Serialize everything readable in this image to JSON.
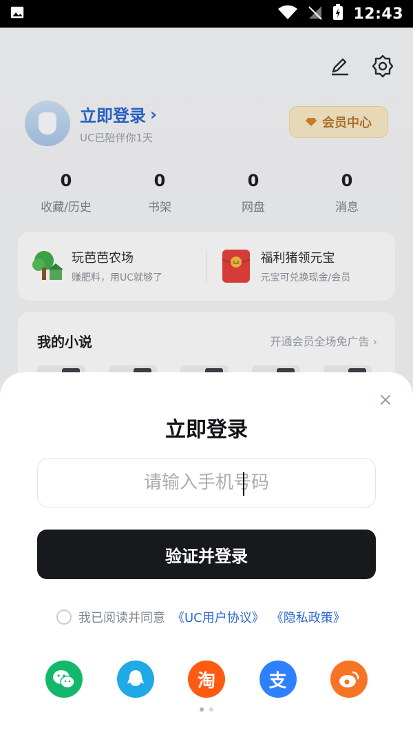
{
  "status_bar": {
    "time": "12:43",
    "icons": [
      "image-icon",
      "wifi-icon",
      "no-signal-icon",
      "battery-charging-icon"
    ]
  },
  "header": {
    "icons": [
      "edit-icon",
      "settings-icon"
    ]
  },
  "profile": {
    "login_label": "立即登录",
    "subtitle": "UC已陪伴你1天",
    "vip_label": "会员中心"
  },
  "stats": [
    {
      "value": "0",
      "label": "收藏/历史"
    },
    {
      "value": "0",
      "label": "书架"
    },
    {
      "value": "0",
      "label": "网盘"
    },
    {
      "value": "0",
      "label": "消息"
    }
  ],
  "promo_cards": [
    {
      "title": "玩芭芭农场",
      "subtitle": "赚肥料，用UC就够了",
      "icon": "farm-tree-icon"
    },
    {
      "title": "福利猪领元宝",
      "subtitle": "元宝可兑换现金/会员",
      "icon": "red-envelope-icon"
    }
  ],
  "novel_section": {
    "title": "我的小说",
    "more": "开通会员全场免广告"
  },
  "login_sheet": {
    "title": "立即登录",
    "phone_placeholder": "请输入手机号码",
    "submit_label": "验证并登录",
    "agreement_text": "我已阅读并同意",
    "user_agreement": "《UC用户协议》",
    "privacy_policy": "《隐私政策》",
    "social_logins": [
      {
        "name": "wechat",
        "icon": "wechat-icon"
      },
      {
        "name": "qq",
        "icon": "qq-icon"
      },
      {
        "name": "taobao",
        "icon": "taobao-icon",
        "glyph": "淘"
      },
      {
        "name": "alipay",
        "icon": "alipay-icon",
        "glyph": "支"
      },
      {
        "name": "weibo",
        "icon": "weibo-icon"
      }
    ]
  }
}
